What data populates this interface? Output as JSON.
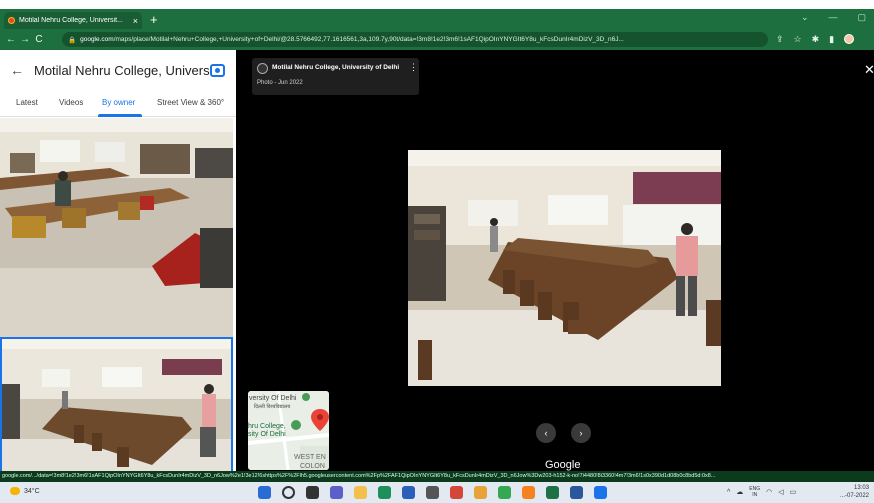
{
  "browser": {
    "tab_title": "Motilal Nehru College, Universit...",
    "tab_close": "×",
    "new_tab": "+",
    "url_host": "google.com",
    "url_path": "/maps/place/Motilal+Nehru+College,+University+of+Delhi/@28.5766492,77.1616561,3a,109.7y,90t/data=!3m8!1e2!3m6!1sAF1QipOInYNYGIt6Y8u_kFcsDunIr4mDizV_3D_n6J...",
    "window_controls": [
      "⌄",
      "—",
      "▢"
    ],
    "accent_color": "#1e6f3f"
  },
  "sidebar": {
    "title": "Motilal Nehru College, University ...",
    "tabs": [
      {
        "label": "Latest",
        "active": false
      },
      {
        "label": "Videos",
        "active": false
      },
      {
        "label": "By owner",
        "active": true
      },
      {
        "label": "Street View & 360°",
        "active": false
      }
    ],
    "active_color": "#1a73e8"
  },
  "viewer": {
    "owner_name": "Motilal Nehru College, University of Delhi",
    "photo_date": "Photo - Jun 2022",
    "attribution": "Google",
    "minimap": {
      "label_top": "versity Of Delhi",
      "label_top_hindi": "दिल्ली विश्वविद्यालय",
      "label_mid_1": "hru College,",
      "label_mid_2": "sity Of Delhi",
      "label_bottom_1": "WEST EN",
      "label_bottom_2": "COLON"
    }
  },
  "status_bar": {
    "text": "google.com/.../data=!3m8!1e2!3m6!1sAF1QipOInYNYGIt6Y8u_kFcsDunIr4mDizV_3D_n6Jow%2e1!3e12!6shttps%2F%2Flh5.googleusercontent.com%2Fp%2FAF1QipOInYNYGIt6Y8u_kFcsDunIr4mDizV_3D_n6Jow%3Dw203-h152-k-no!7i4480!8i3360!4m7!3m6!1s0x390d1d08b0c8bd5d:0x8..."
  },
  "taskbar": {
    "weather": "34°C",
    "lang_top": "ENG",
    "lang_bottom": "IN",
    "time": "13:03",
    "date": "...-07-2022"
  }
}
